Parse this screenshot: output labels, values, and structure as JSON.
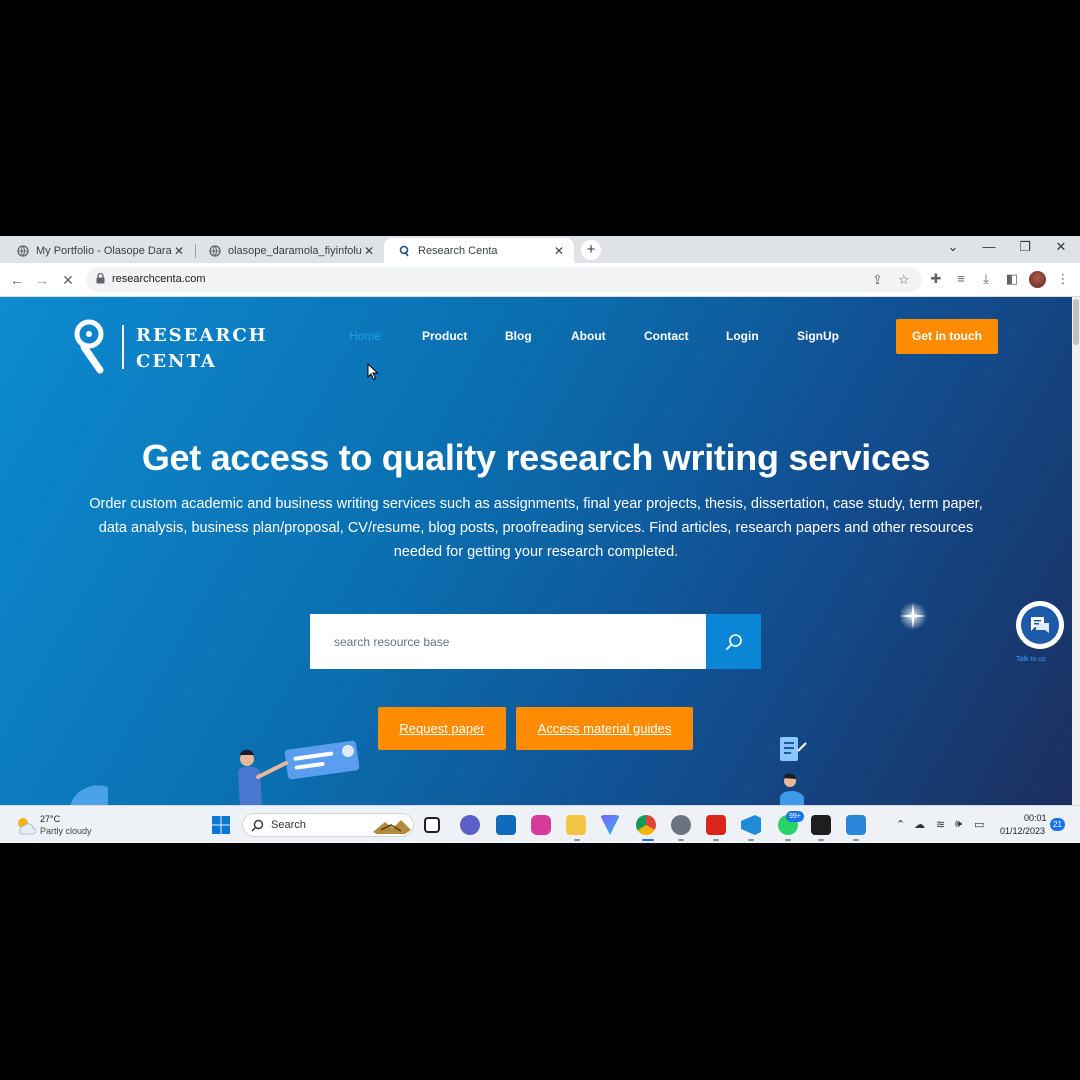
{
  "browser": {
    "tabs": [
      {
        "title": "My Portfolio - Olasope Daramola"
      },
      {
        "title": "olasope_daramola_fiyinfoluwa_c"
      },
      {
        "title": "Research Centa"
      }
    ],
    "active_tab": 2,
    "url": "researchcenta.com"
  },
  "site": {
    "logo_line1": "RESEARCH",
    "logo_line2": "CENTA",
    "nav": [
      "Home",
      "Product",
      "Blog",
      "About",
      "Contact",
      "Login",
      "SignUp"
    ],
    "active_nav": "Home",
    "cta_label": "Get in touch",
    "hero_title": "Get access to quality research writing services",
    "hero_subtitle": "Order custom academic and business writing services such as assignments, final year projects, thesis, dissertation, case study, term paper, data analysis, business plan/proposal, CV/resume, blog posts, proofreading services. Find articles, research papers and other resources needed for getting your research completed.",
    "search_placeholder": "search resource base",
    "buttons": {
      "request": "Request paper",
      "guides": "Access material guides"
    },
    "chat_label": "Talk to us"
  },
  "taskbar": {
    "temperature": "27°C",
    "weather": "Partly cloudy",
    "search_label": "Search",
    "whatsapp_badge": "99+",
    "time": "00:01",
    "date": "01/12/2023",
    "notifications": "21"
  },
  "colors": {
    "accent_orange": "#ff8c00",
    "hero_blue": "#0b86d6",
    "nav_active": "#1aa3e8"
  }
}
